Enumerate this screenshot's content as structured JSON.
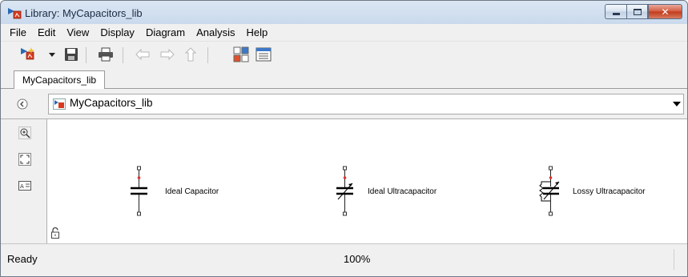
{
  "window": {
    "title": "Library: MyCapacitors_lib",
    "close_glyph": "✕"
  },
  "menu": [
    "File",
    "Edit",
    "View",
    "Display",
    "Diagram",
    "Analysis",
    "Help"
  ],
  "toolbar": {
    "icons": [
      "new-library-icon",
      "dropdown-arrow-icon",
      "save-icon",
      "print-icon",
      "back-arrow-icon",
      "forward-arrow-icon",
      "up-arrow-icon",
      "library-browser-icon",
      "model-explorer-icon"
    ]
  },
  "tab": {
    "label": "MyCapacitors_lib"
  },
  "address": {
    "path": "MyCapacitors_lib"
  },
  "blocks": [
    {
      "label": "Ideal Capacitor",
      "icon": "ideal-capacitor-icon"
    },
    {
      "label": "Ideal Ultracapacitor",
      "icon": "ideal-ultracapacitor-icon"
    },
    {
      "label": "Lossy Ultracapacitor",
      "icon": "lossy-ultracapacitor-icon"
    }
  ],
  "left_tools": [
    "zoom-in-icon",
    "fit-to-view-icon",
    "text-annotation-icon"
  ],
  "status": {
    "state": "Ready",
    "zoom": "100%"
  },
  "colors": {
    "window_frame": "#c9d9ec",
    "close_button": "#c2391b",
    "chrome": "#f0f0f0",
    "port_red": "#e03030"
  }
}
